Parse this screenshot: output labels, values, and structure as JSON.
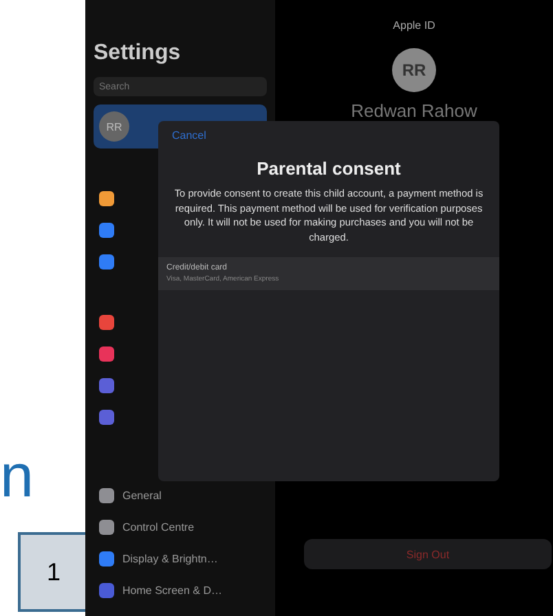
{
  "side_label": "n",
  "step_badge": "1",
  "settings": {
    "title": "Settings",
    "search": {
      "placeholder": "Search"
    },
    "profile": {
      "initials": "RR",
      "selected": true
    },
    "items": [
      {
        "color": "#f09a37"
      },
      {
        "color": "#2f7cf6"
      },
      {
        "color": "#2f7cf6"
      },
      {
        "color": "#e8453c"
      },
      {
        "color": "#e8335a"
      },
      {
        "color": "#5b5fd6"
      },
      {
        "color": "#5b5fd6"
      },
      {
        "color": "#8e8e93",
        "label": "General"
      },
      {
        "color": "#8e8e93",
        "label": "Control Centre"
      },
      {
        "color": "#2f7cf6",
        "label": "Display & Brightn…"
      },
      {
        "color": "#4a5bd6",
        "label": "Home Screen & D…"
      }
    ]
  },
  "apple_id": {
    "title": "Apple ID",
    "initials": "RR",
    "name": "Redwan Rahow",
    "sign_out": "Sign Out"
  },
  "modal": {
    "cancel": "Cancel",
    "title": "Parental consent",
    "message": "To provide consent to create this child account, a payment method is required. This payment method will be used for verification purposes only. It will not be used for making purchases and you will not be charged.",
    "options": [
      {
        "title": "Credit/debit card",
        "subtitle": "Visa, MasterCard, American Express"
      }
    ]
  }
}
